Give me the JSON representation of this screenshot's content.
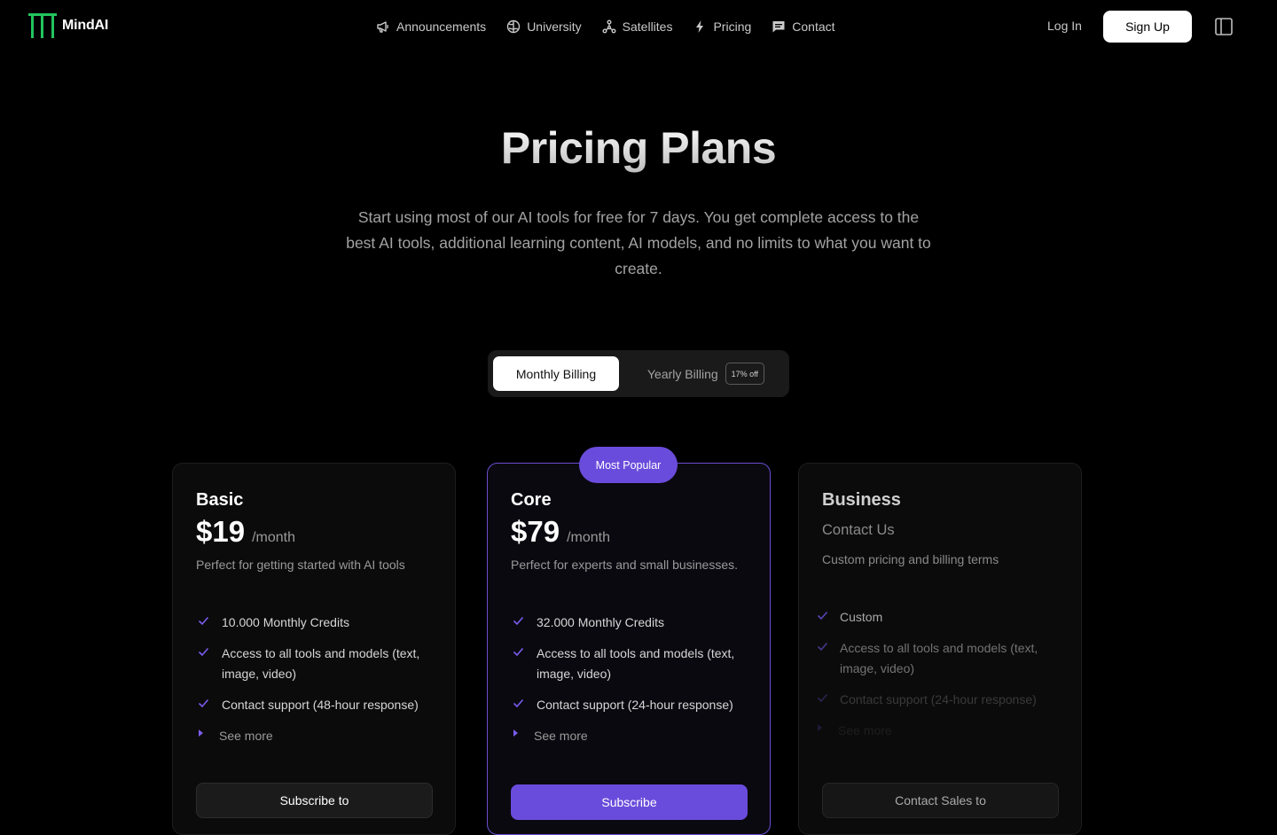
{
  "brand": {
    "name": "MindAI",
    "accent": "#22c55e"
  },
  "nav": {
    "links": [
      {
        "label": "Announcements",
        "icon": "megaphone-icon"
      },
      {
        "label": "University",
        "icon": "brain-icon"
      },
      {
        "label": "Satellites",
        "icon": "network-icon"
      },
      {
        "label": "Pricing",
        "icon": "lightning-icon"
      },
      {
        "label": "Contact",
        "icon": "message-icon"
      }
    ],
    "login_label": "Log In",
    "signup_label": "Sign Up"
  },
  "hero": {
    "title": "Pricing Plans",
    "subtitle": "Start using most of our AI tools for free for 7 days. You get complete access to the best AI tools, additional learning content, AI models, and no limits to what you want to create."
  },
  "billing": {
    "monthly_label": "Monthly Billing",
    "yearly_label": "Yearly Billing",
    "yearly_badge": "17% off",
    "selected": "monthly"
  },
  "plans": {
    "basic": {
      "name": "Basic",
      "price": "$19",
      "period": "/month",
      "description": "Perfect for getting started with AI tools",
      "features": [
        "10.000 Monthly Credits",
        "Access to all tools and models (text, image, video)",
        "Contact support (48-hour response)"
      ],
      "see_more": "See more",
      "cta": "Subscribe to"
    },
    "core": {
      "badge": "Most Popular",
      "name": "Core",
      "price": "$79",
      "period": "/month",
      "description": "Perfect for experts and small businesses.",
      "features": [
        "32.000 Monthly Credits",
        "Access to all tools and models (text, image, video)",
        "Contact support (24-hour response)"
      ],
      "see_more": "See more",
      "cta": "Subscribe"
    },
    "business": {
      "name": "Business",
      "price_label": "Contact Us",
      "description": "Custom pricing and billing terms",
      "features": [
        "Custom",
        "Access to all tools and models (text, image, video)",
        "Contact support (24-hour response)"
      ],
      "see_more": "See more",
      "cta": "Contact Sales to"
    }
  },
  "colors": {
    "purple": "#6a4cdc",
    "background": "#000000"
  }
}
